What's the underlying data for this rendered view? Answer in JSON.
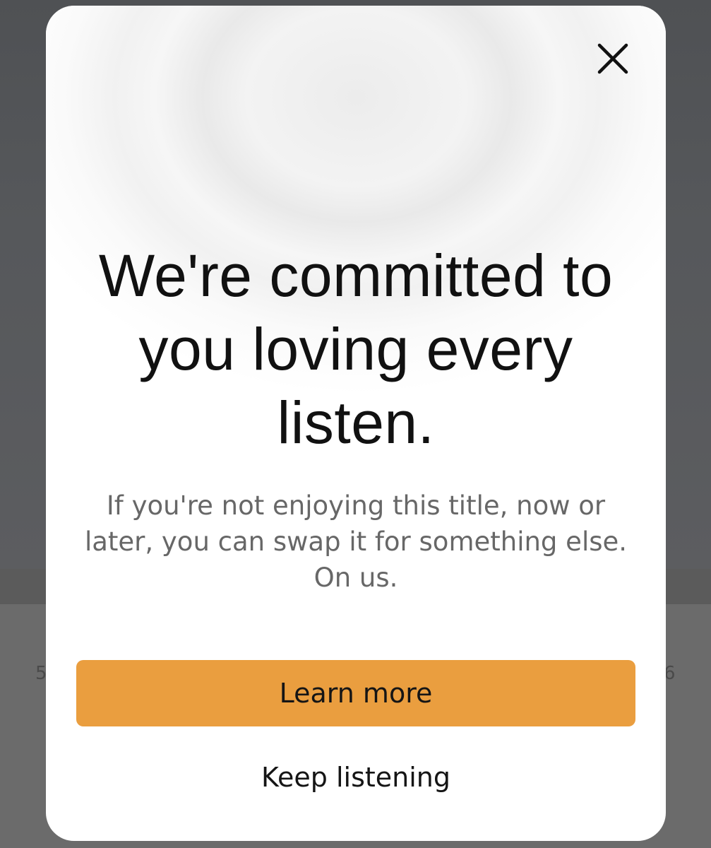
{
  "background": {
    "left_number": "5",
    "right_number": "6"
  },
  "modal": {
    "close_icon": "close-icon",
    "headline_line1": "We're committed to",
    "headline_line2": "you loving every",
    "headline_line3": "listen.",
    "body_line1": "If you're not enjoying this title, now or",
    "body_line2": "later, you can swap it for something else.",
    "body_line3": "On us.",
    "primary_button_label": "Learn more",
    "secondary_button_label": "Keep listening"
  },
  "colors": {
    "accent": "#ea9e3f",
    "backdrop": "#595a5d",
    "headline_text": "#111111",
    "body_text": "#676767"
  }
}
